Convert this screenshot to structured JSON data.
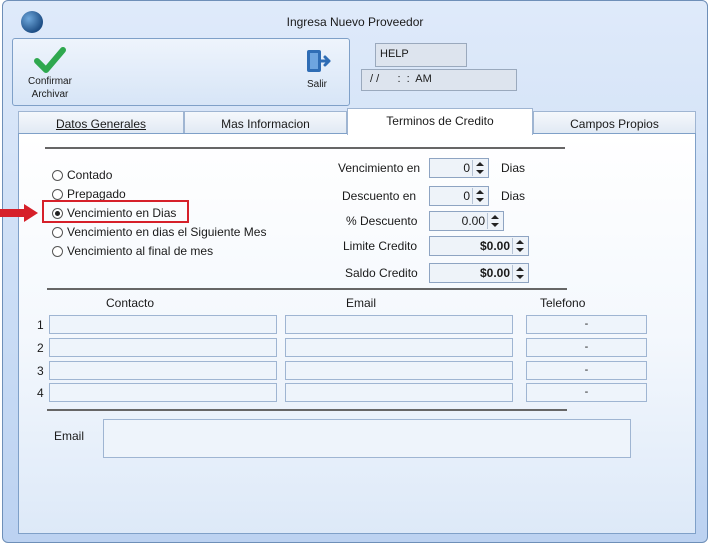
{
  "window": {
    "title": "Ingresa Nuevo Proveedor"
  },
  "toolbar": {
    "confirm_label_1": "Confirmar",
    "confirm_label_2": "Archivar",
    "exit_label": "Salir",
    "help_text": "HELP",
    "datetime_text": "/ /      :  :  AM"
  },
  "tabs": [
    {
      "label": "Datos Generales"
    },
    {
      "label": "Mas Informacion"
    },
    {
      "label": "Terminos de Credito"
    },
    {
      "label": "Campos Propios"
    }
  ],
  "credit_type": {
    "options": [
      {
        "label": "Contado",
        "checked": false
      },
      {
        "label": "Prepagado",
        "checked": false
      },
      {
        "label": "Vencimiento en Dias",
        "checked": true
      },
      {
        "label": "Vencimiento en dias el Siguiente Mes",
        "checked": false
      },
      {
        "label": "Vencimiento al final de mes",
        "checked": false
      }
    ]
  },
  "fields": {
    "vencimiento_label": "Vencimiento en",
    "vencimiento_value": "0",
    "vencimiento_unit": "Dias",
    "descuento_label": "Descuento en",
    "descuento_value": "0",
    "descuento_unit": "Dias",
    "pct_descuento_label": "% Descuento",
    "pct_descuento_value": "0.00",
    "limite_label": "Limite Credito",
    "limite_value": "$0.00",
    "saldo_label": "Saldo Credito",
    "saldo_value": "$0.00"
  },
  "contacts": {
    "headers": {
      "contacto": "Contacto",
      "email": "Email",
      "telefono": "Telefono"
    },
    "rows": [
      {
        "num": "1",
        "contacto": "",
        "email": "",
        "telefono": "-"
      },
      {
        "num": "2",
        "contacto": "",
        "email": "",
        "telefono": "-"
      },
      {
        "num": "3",
        "contacto": "",
        "email": "",
        "telefono": "-"
      },
      {
        "num": "4",
        "contacto": "",
        "email": "",
        "telefono": "-"
      }
    ]
  },
  "email_section": {
    "label": "Email",
    "value": ""
  },
  "colors": {
    "highlight": "#d6202a",
    "accent": "#2f6db5"
  }
}
